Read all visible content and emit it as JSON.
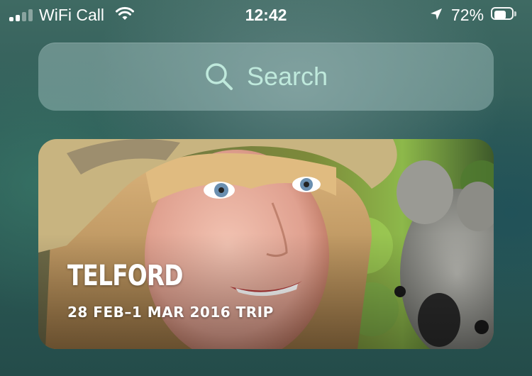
{
  "status_bar": {
    "carrier": "WiFi Call",
    "time": "12:42",
    "battery_percent": "72%",
    "battery_level": 0.72,
    "signal_bars": 2,
    "signal_total": 4
  },
  "search": {
    "placeholder": "Search"
  },
  "memory": {
    "title": "TELFORD",
    "subtitle": "28 FEB–1 MAR 2016 TRIP"
  }
}
